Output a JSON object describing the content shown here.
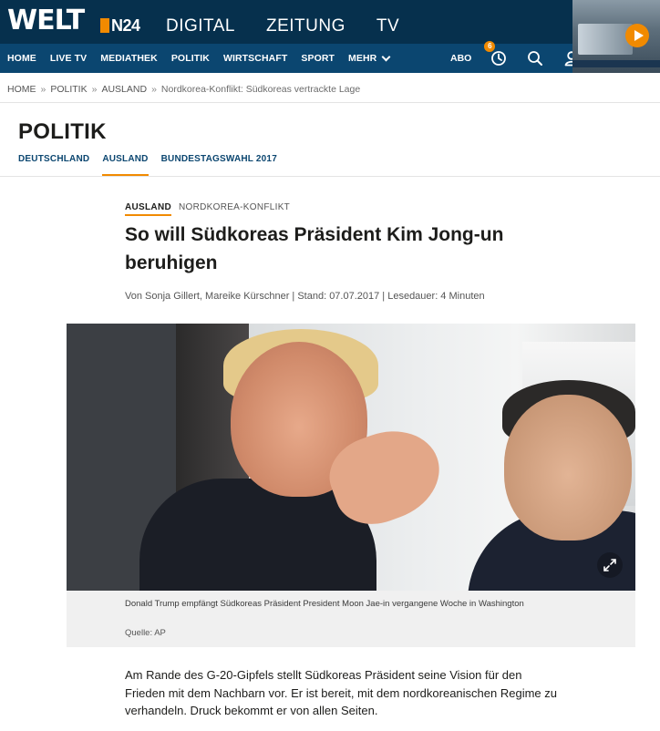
{
  "header": {
    "logo_welt": "WELT",
    "logo_n24": "N24",
    "top_links": [
      "DIGITAL",
      "ZEITUNG",
      "TV"
    ],
    "brand_color": "#06304d",
    "accent_color": "#f18a00"
  },
  "nav": {
    "items": [
      "HOME",
      "LIVE TV",
      "MEDIATHEK",
      "POLITIK",
      "WIRTSCHAFT",
      "SPORT"
    ],
    "more_label": "MEHR",
    "abo_label": "ABO",
    "badge_count": "6",
    "icons": [
      "clock-icon",
      "search-icon",
      "user-icon",
      "play-icon"
    ]
  },
  "breadcrumb": {
    "items": [
      "HOME",
      "POLITIK",
      "AUSLAND",
      "Nordkorea-Konflikt: Südkoreas vertrackte Lage"
    ],
    "separator": "»"
  },
  "section": {
    "title": "POLITIK",
    "tabs": [
      "DEUTSCHLAND",
      "AUSLAND",
      "BUNDESTAGSWAHL 2017"
    ],
    "active_tab": "AUSLAND"
  },
  "article": {
    "kicker_primary": "AUSLAND",
    "kicker_secondary": "NORDKOREA-KONFLIKT",
    "headline": "So will Südkoreas Präsident Kim Jong-un beruhigen",
    "byline": "Von Sonja Gillert, Mareike Kürschner | Stand: 07.07.2017 | Lesedauer: 4 Minuten",
    "image_caption": "Donald Trump empfängt Südkoreas Präsident President Moon Jae-in vergangene Woche in Washington",
    "image_source": "Quelle: AP",
    "teaser": "Am Rande des G-20-Gipfels stellt Südkoreas Präsident seine Vision für den Frieden mit dem Nachbarn vor. Er ist bereit, mit dem nordkoreanischen Regime zu verhandeln. Druck bekommt er von allen Seiten."
  }
}
